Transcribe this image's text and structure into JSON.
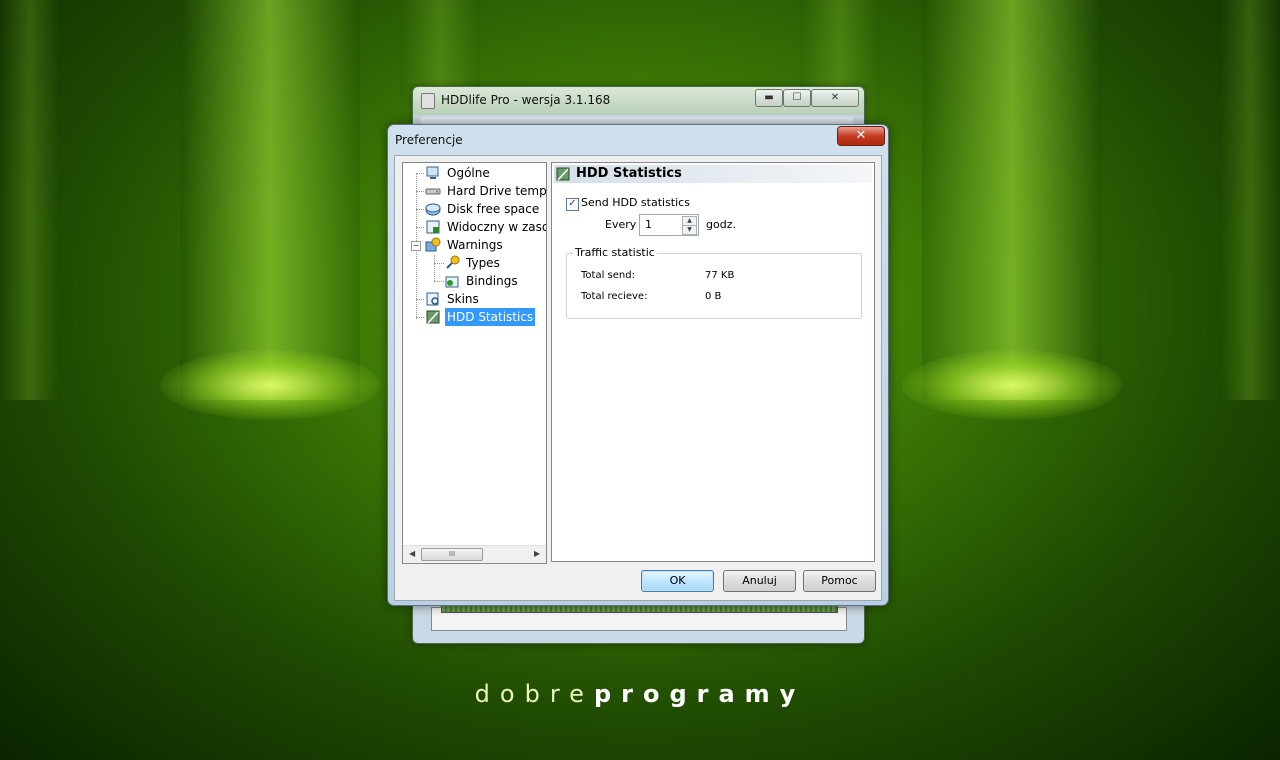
{
  "wallpaper": {
    "logo_light": "dobre",
    "logo_bold": "programy"
  },
  "background_window": {
    "title": "HDDlife Pro - wersja 3.1.168",
    "minimize_label": "▬",
    "maximize_label": "☐",
    "close_label": "✕"
  },
  "dialog": {
    "title": "Preferencje",
    "close_label": "✕",
    "tree": {
      "items": [
        {
          "label": "Ogólne",
          "icon": "monitor-icon"
        },
        {
          "label": "Hard Drive temper",
          "icon": "hard-drive-icon"
        },
        {
          "label": "Disk free space",
          "icon": "disk-space-icon"
        },
        {
          "label": "Widoczny w zasob",
          "icon": "system-tray-icon"
        },
        {
          "label": "Warnings",
          "icon": "warnings-icon"
        },
        {
          "label": "Types",
          "icon": "types-icon"
        },
        {
          "label": "Bindings",
          "icon": "bindings-icon"
        },
        {
          "label": "Skins",
          "icon": "skins-icon"
        },
        {
          "label": "HDD Statistics",
          "icon": "statistics-icon"
        }
      ],
      "selected": "HDD Statistics",
      "scroll_thumb": "III"
    },
    "panel": {
      "header": "HDD Statistics",
      "send_checkbox_label": "Send HDD statistics",
      "send_checked": true,
      "every_label": "Every",
      "every_value": "1",
      "unit_label": "godz.",
      "group_title": "Traffic statistic",
      "stats": [
        {
          "label": "Total send:",
          "value": "77 KB"
        },
        {
          "label": "Total recieve:",
          "value": "0 B"
        }
      ]
    },
    "buttons": {
      "ok": "OK",
      "cancel": "Anuluj",
      "help": "Pomoc"
    }
  },
  "colors": {
    "selection": "#3399ff",
    "close_red": "#c43a20",
    "wallpaper_green": "#3f7d06"
  }
}
